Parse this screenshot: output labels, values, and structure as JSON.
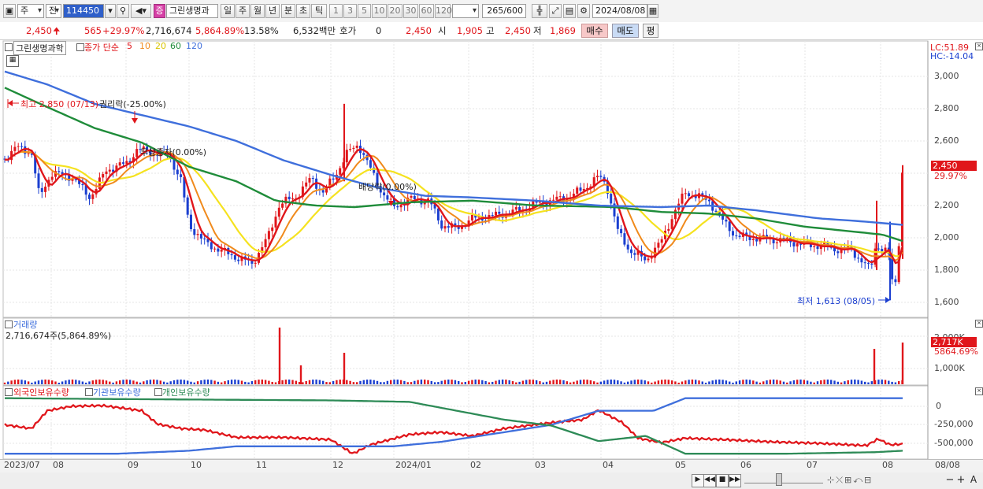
{
  "toolbar": {
    "period_select": "주",
    "prev_label": "전",
    "code": "114450",
    "stock_badge": "증",
    "stock_name": "그린생명과",
    "period_tabs": [
      "일",
      "주",
      "월",
      "년",
      "분",
      "초",
      "틱"
    ],
    "active_tab": "일",
    "intervals": [
      "1",
      "3",
      "5",
      "10",
      "20",
      "30",
      "60",
      "120"
    ],
    "count": "265",
    "count_max": "/600",
    "date": "2024/08/08"
  },
  "quote": {
    "price": "2,450",
    "change": "565",
    "change_pct": "+29.97%",
    "volume": "2,716,674",
    "volume_pct": "5,864.89%",
    "turnover": "13.58%",
    "amount": "6,532백만",
    "hoga_label": "호가",
    "hoga_value": "0",
    "ask_price": "2,450",
    "open_label": "시",
    "open": "1,905",
    "high_label": "고",
    "high": "2,450",
    "low_label": "저",
    "low": "1,869",
    "buy_button": "매수",
    "sell_button": "매도",
    "eval_button": "평"
  },
  "price_panel": {
    "name": "그린생명과학",
    "ma_label": "종가 단순",
    "ma_periods": [
      {
        "label": "5",
        "color": "#e0161b"
      },
      {
        "label": "10",
        "color": "#f08a1c"
      },
      {
        "label": "20",
        "color": "#e8d81c"
      },
      {
        "label": "60",
        "color": "#1f8c3a"
      },
      {
        "label": "120",
        "color": "#3f6fdc"
      }
    ],
    "lc": "LC:51.89",
    "hc": "HC:-14.04",
    "y_ticks": [
      "3,000",
      "2,800",
      "2,600",
      "2,400",
      "2,200",
      "2,000",
      "1,800",
      "1,600"
    ],
    "last_price_tag": "2,450",
    "last_change_tag": "29.97%",
    "annotations": {
      "high": "최고 2,850 (07/13)",
      "rights": "권리락(-25.00%)",
      "bonus": "무상증자(0.00%)",
      "ex_div": "배당락(0.00%)",
      "low": "최저 1,613 (08/05)"
    }
  },
  "volume_panel": {
    "title": "거래량",
    "value": "2,716,674주(5,864.89%)",
    "y_ticks": [
      "2,000K",
      "1,000K"
    ],
    "last_tag": "2,717K",
    "last_pct_tag": "5864.69%"
  },
  "holdings_panel": {
    "legend": [
      {
        "label": "외국인보유수량",
        "color": "#e0161b"
      },
      {
        "label": "기관보유수량",
        "color": "#3f6fdc"
      },
      {
        "label": "개인보유수량",
        "color": "#2e8b57"
      }
    ],
    "y_ticks": [
      "0",
      "-250,000",
      "-500,000"
    ]
  },
  "x_axis": {
    "labels": [
      "2023/07",
      "08",
      "09",
      "10",
      "11",
      "12",
      "2024/01",
      "02",
      "03",
      "04",
      "05",
      "06",
      "07",
      "08"
    ],
    "right_label": "08/08"
  },
  "colors": {
    "up": "#e0161b",
    "down": "#1b3fd0",
    "ma5": "#e0161b",
    "ma10": "#f08a1c",
    "ma20": "#f5e21f",
    "ma60": "#1f8c3a",
    "ma120": "#3f6fdc"
  }
}
